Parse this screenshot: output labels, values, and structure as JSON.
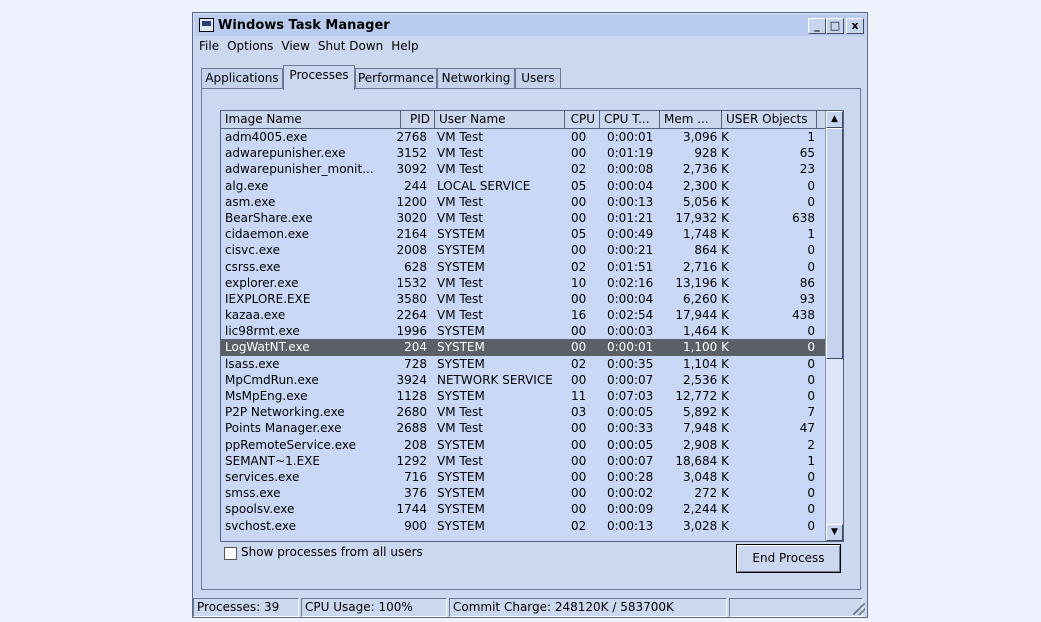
{
  "window": {
    "title": "Windows Task Manager",
    "minimize": "_",
    "maximize": "□",
    "close": "x"
  },
  "menu": [
    "File",
    "Options",
    "View",
    "Shut Down",
    "Help"
  ],
  "tabs": [
    "Applications",
    "Processes",
    "Performance",
    "Networking",
    "Users"
  ],
  "active_tab": "Processes",
  "columns": [
    "Image Name",
    "PID",
    "User Name",
    "CPU",
    "CPU T...",
    "Mem ...",
    "USER Objects"
  ],
  "processes": [
    {
      "name": "adm4005.exe",
      "pid": "2768",
      "user": "VM Test",
      "cpu": "00",
      "time": "0:00:01",
      "mem": "3,096 K",
      "uo": "1"
    },
    {
      "name": "adwarepunisher.exe",
      "pid": "3152",
      "user": "VM Test",
      "cpu": "00",
      "time": "0:01:19",
      "mem": "928 K",
      "uo": "65"
    },
    {
      "name": "adwarepunisher_monit...",
      "pid": "3092",
      "user": "VM Test",
      "cpu": "02",
      "time": "0:00:08",
      "mem": "2,736 K",
      "uo": "23"
    },
    {
      "name": "alg.exe",
      "pid": "244",
      "user": "LOCAL SERVICE",
      "cpu": "05",
      "time": "0:00:04",
      "mem": "2,300 K",
      "uo": "0"
    },
    {
      "name": "asm.exe",
      "pid": "1200",
      "user": "VM Test",
      "cpu": "00",
      "time": "0:00:13",
      "mem": "5,056 K",
      "uo": "0"
    },
    {
      "name": "BearShare.exe",
      "pid": "3020",
      "user": "VM Test",
      "cpu": "00",
      "time": "0:01:21",
      "mem": "17,932 K",
      "uo": "638"
    },
    {
      "name": "cidaemon.exe",
      "pid": "2164",
      "user": "SYSTEM",
      "cpu": "05",
      "time": "0:00:49",
      "mem": "1,748 K",
      "uo": "1"
    },
    {
      "name": "cisvc.exe",
      "pid": "2008",
      "user": "SYSTEM",
      "cpu": "00",
      "time": "0:00:21",
      "mem": "864 K",
      "uo": "0"
    },
    {
      "name": "csrss.exe",
      "pid": "628",
      "user": "SYSTEM",
      "cpu": "02",
      "time": "0:01:51",
      "mem": "2,716 K",
      "uo": "0"
    },
    {
      "name": "explorer.exe",
      "pid": "1532",
      "user": "VM Test",
      "cpu": "10",
      "time": "0:02:16",
      "mem": "13,196 K",
      "uo": "86"
    },
    {
      "name": "IEXPLORE.EXE",
      "pid": "3580",
      "user": "VM Test",
      "cpu": "00",
      "time": "0:00:04",
      "mem": "6,260 K",
      "uo": "93"
    },
    {
      "name": "kazaa.exe",
      "pid": "2264",
      "user": "VM Test",
      "cpu": "16",
      "time": "0:02:54",
      "mem": "17,944 K",
      "uo": "438"
    },
    {
      "name": "lic98rmt.exe",
      "pid": "1996",
      "user": "SYSTEM",
      "cpu": "00",
      "time": "0:00:03",
      "mem": "1,464 K",
      "uo": "0"
    },
    {
      "name": "LogWatNT.exe",
      "pid": "204",
      "user": "SYSTEM",
      "cpu": "00",
      "time": "0:00:01",
      "mem": "1,100 K",
      "uo": "0",
      "selected": true
    },
    {
      "name": "lsass.exe",
      "pid": "728",
      "user": "SYSTEM",
      "cpu": "02",
      "time": "0:00:35",
      "mem": "1,104 K",
      "uo": "0"
    },
    {
      "name": "MpCmdRun.exe",
      "pid": "3924",
      "user": "NETWORK SERVICE",
      "cpu": "00",
      "time": "0:00:07",
      "mem": "2,536 K",
      "uo": "0"
    },
    {
      "name": "MsMpEng.exe",
      "pid": "1128",
      "user": "SYSTEM",
      "cpu": "11",
      "time": "0:07:03",
      "mem": "12,772 K",
      "uo": "0"
    },
    {
      "name": "P2P Networking.exe",
      "pid": "2680",
      "user": "VM Test",
      "cpu": "03",
      "time": "0:00:05",
      "mem": "5,892 K",
      "uo": "7"
    },
    {
      "name": "Points Manager.exe",
      "pid": "2688",
      "user": "VM Test",
      "cpu": "00",
      "time": "0:00:33",
      "mem": "7,948 K",
      "uo": "47"
    },
    {
      "name": "ppRemoteService.exe",
      "pid": "208",
      "user": "SYSTEM",
      "cpu": "00",
      "time": "0:00:05",
      "mem": "2,908 K",
      "uo": "2"
    },
    {
      "name": "SEMANT~1.EXE",
      "pid": "1292",
      "user": "VM Test",
      "cpu": "00",
      "time": "0:00:07",
      "mem": "18,684 K",
      "uo": "1"
    },
    {
      "name": "services.exe",
      "pid": "716",
      "user": "SYSTEM",
      "cpu": "00",
      "time": "0:00:28",
      "mem": "3,048 K",
      "uo": "0"
    },
    {
      "name": "smss.exe",
      "pid": "376",
      "user": "SYSTEM",
      "cpu": "00",
      "time": "0:00:02",
      "mem": "272 K",
      "uo": "0"
    },
    {
      "name": "spoolsv.exe",
      "pid": "1744",
      "user": "SYSTEM",
      "cpu": "00",
      "time": "0:00:09",
      "mem": "2,244 K",
      "uo": "0"
    },
    {
      "name": "svchost.exe",
      "pid": "900",
      "user": "SYSTEM",
      "cpu": "02",
      "time": "0:00:13",
      "mem": "3,028 K",
      "uo": "0"
    }
  ],
  "show_all_label": "Show processes from all users",
  "end_process_label": "End Process",
  "status": {
    "processes": "Processes: 39",
    "cpu": "CPU Usage: 100%",
    "commit": "Commit Charge: 248120K / 583700K"
  },
  "colors": {
    "background": "#eef1fe",
    "window": "#ccd8f0",
    "list": "#cad8f7",
    "selected_row": "#5b5f68"
  }
}
